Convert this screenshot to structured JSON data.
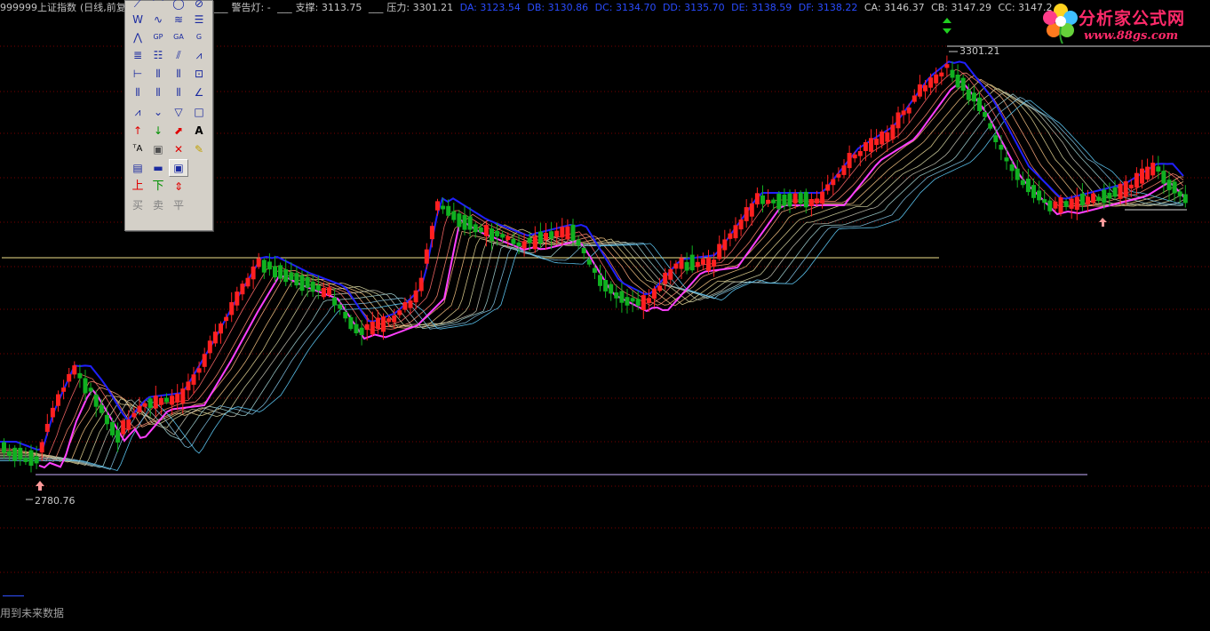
{
  "header": {
    "code": "999999",
    "name": "上证指数",
    "period": "(日线,前复",
    "alert_label": "警告灯: -",
    "support_label": "支撑: 3113.75",
    "pressure_label": "压力: 3301.21",
    "da": "DA: 3123.54",
    "db": "DB: 3130.86",
    "dc": "DC: 3134.70",
    "dd": "DD: 3135.70",
    "de": "DE: 3138.59",
    "df": "DF: 3138.22",
    "ca": "CA: 3146.37",
    "cb": "CB: 3147.29",
    "cc": "CC: 3147.2"
  },
  "colors": {
    "up": "#ff2020",
    "down": "#10b020",
    "blue_line": "#2020ff",
    "magenta_line": "#ff40ff",
    "level_line": "#f0e08a",
    "low_line": "#c8b0ff",
    "high_line": "#d8d8d8"
  },
  "annotations": {
    "high_value": "3301.21",
    "low_value": "2780.76"
  },
  "toolbox": {
    "row_buy": "买",
    "row_sell": "卖",
    "row_flat": "平",
    "up_char": "上",
    "down_char": "下",
    "text_tool": "A"
  },
  "logo": {
    "title": "分析家公式网",
    "url": "www.88gs.com"
  },
  "footer": {
    "note": "用到未来数据"
  }
}
